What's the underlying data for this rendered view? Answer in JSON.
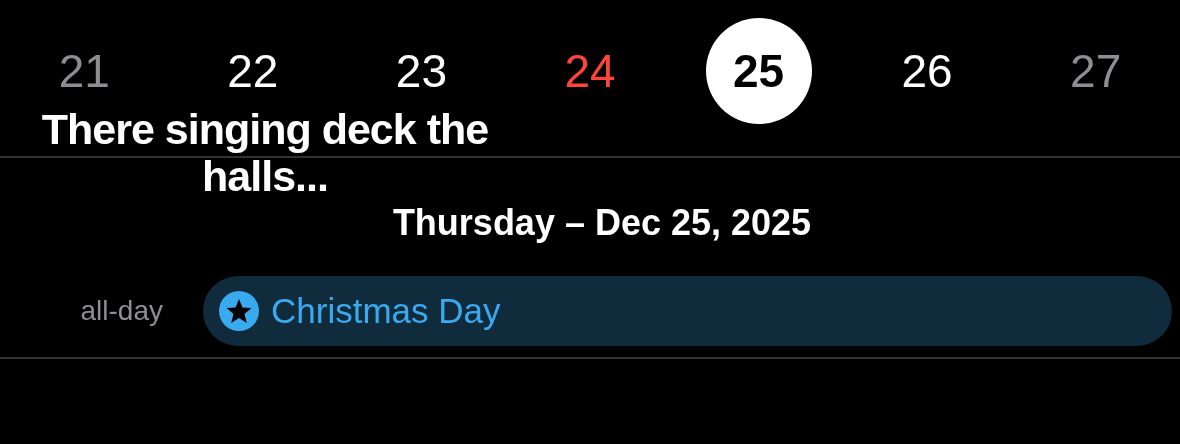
{
  "week": [
    {
      "label": "21",
      "selected": false,
      "today": false,
      "weekend": true
    },
    {
      "label": "22",
      "selected": false,
      "today": false,
      "weekend": false
    },
    {
      "label": "23",
      "selected": false,
      "today": false,
      "weekend": false
    },
    {
      "label": "24",
      "selected": false,
      "today": true,
      "weekend": false
    },
    {
      "label": "25",
      "selected": true,
      "today": false,
      "weekend": false
    },
    {
      "label": "26",
      "selected": false,
      "today": false,
      "weekend": false
    },
    {
      "label": "27",
      "selected": false,
      "today": false,
      "weekend": true
    }
  ],
  "caption": "There singing deck the halls...",
  "date_title": "Thursday – Dec 25, 2025",
  "all_day": {
    "label": "all-day",
    "events": [
      {
        "title": "Christmas Day",
        "color": "#3aaaf0"
      }
    ]
  }
}
